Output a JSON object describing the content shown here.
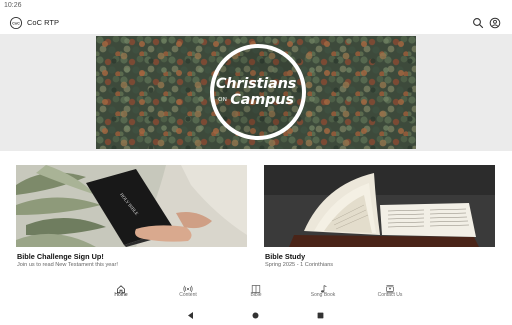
{
  "status_bar": {
    "time": "10:26"
  },
  "app_bar": {
    "title": "CoC RTP",
    "logo_icon": "coc-logo-icon",
    "search_icon": "search-icon",
    "account_icon": "account-circle-icon"
  },
  "hero": {
    "line1": "Christians",
    "line2_small": "ON",
    "line2": "Campus"
  },
  "cards": [
    {
      "title": "Bible Challenge Sign Up!",
      "subtitle": "Join us to read New Testament this year!",
      "image": "holy-bible-photo",
      "image_text": "HOLY BIBLE"
    },
    {
      "title": "Bible Study",
      "subtitle": "Spring 2025 - 1 Corinthians",
      "image": "open-bible-photo"
    }
  ],
  "bottom_nav": [
    {
      "label": "Home",
      "icon": "home-icon",
      "active": true
    },
    {
      "label": "Content",
      "icon": "broadcast-icon",
      "active": false
    },
    {
      "label": "Bible",
      "icon": "book-icon",
      "active": false
    },
    {
      "label": "Song Book",
      "icon": "music-note-icon",
      "active": false
    },
    {
      "label": "Contact Us",
      "icon": "contacts-icon",
      "active": false
    }
  ],
  "system_nav": [
    "back-icon",
    "home-circle-icon",
    "recents-icon"
  ],
  "colors": {
    "accent": "#1c1c1c",
    "hero_band": "#ebebeb",
    "forest_dark": "#3a4a3a"
  }
}
